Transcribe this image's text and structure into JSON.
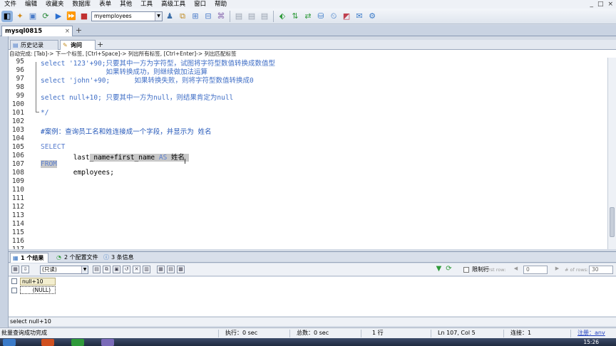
{
  "menu": {
    "items": [
      "文件",
      "编辑",
      "收藏夹",
      "数据库",
      "表单",
      "其他",
      "工具",
      "高级工具",
      "窗口",
      "帮助"
    ],
    "window_controls": [
      "_",
      "□",
      "×"
    ]
  },
  "toolbar": {
    "db_select_value": "myemployees"
  },
  "connection_tab": {
    "label": "mysql0815",
    "close": "×",
    "add": "+"
  },
  "editor_tabs": {
    "history_label": "历史记录",
    "query_label": "询问",
    "add": "+"
  },
  "hint": "自动完成: [Tab]-> 下一个标签, [Ctrl+Space]-> 列出所有标签, [Ctrl+Enter]-> 列出匹配标签",
  "editor": {
    "lines": [
      {
        "num": "95",
        "text": "select '123'+90;只要其中一方为字符型，试图将字符型数值转换成数值型"
      },
      {
        "num": "96",
        "text": "                如果转换成功，则继续做加法运算"
      },
      {
        "num": "97",
        "text": "select 'john'+90;      如果转换失败，则将字符型数值转换成0"
      },
      {
        "num": "98",
        "text": ""
      },
      {
        "num": "99",
        "text": "select null+10; 只要其中一方为null，则结果肯定为null"
      },
      {
        "num": "100",
        "text": ""
      },
      {
        "num": "101",
        "text": "*/"
      },
      {
        "num": "102",
        "text": ""
      },
      {
        "num": "103",
        "text": "#案例：查询员工名和姓连接成一个字段，并显示为 姓名"
      },
      {
        "num": "104",
        "text": ""
      },
      {
        "num": "105",
        "kw": "SELECT"
      },
      {
        "num": "106",
        "lead": "        last",
        "sel": "_name+first_name ",
        "kw_sel": "AS",
        "sel2": " 姓名 "
      },
      {
        "num": "107",
        "kw_sel_only": "FROM"
      },
      {
        "num": "108",
        "text": "        employees;"
      },
      {
        "num": "109",
        "text": ""
      },
      {
        "num": "110",
        "text": ""
      },
      {
        "num": "111",
        "text": ""
      },
      {
        "num": "112",
        "text": ""
      },
      {
        "num": "113",
        "text": ""
      },
      {
        "num": "114",
        "text": ""
      },
      {
        "num": "115",
        "text": ""
      },
      {
        "num": "116",
        "text": ""
      },
      {
        "num": "117",
        "text": ""
      }
    ]
  },
  "result_tabs": {
    "results": "1 个结果",
    "profile": "2 个配置文件",
    "messages": "3 条信息"
  },
  "result_toolbar": {
    "readonly_value": "(只读)",
    "limit_label": "限制行",
    "first_row_label": "First row:",
    "first_row_value": "0",
    "rows_label": "# of rows:",
    "rows_value": "30"
  },
  "grid": {
    "column": "null+10",
    "cell": "(NULL)"
  },
  "query_echo": "select null+10",
  "status": {
    "message": "批量查询成功完成",
    "exec": "执行：0 sec",
    "total": "总数：0 sec",
    "rows": "1 行",
    "position": "Ln 107, Col 5",
    "connections": "连接：1",
    "register": "注册：anv"
  },
  "taskbar": {
    "clock": "15:26"
  },
  "colors": {
    "keyword": "#5b7fcf",
    "comment": "#3f6ec6",
    "selection": "#c8c8c8",
    "register": "#1f3fbf"
  }
}
